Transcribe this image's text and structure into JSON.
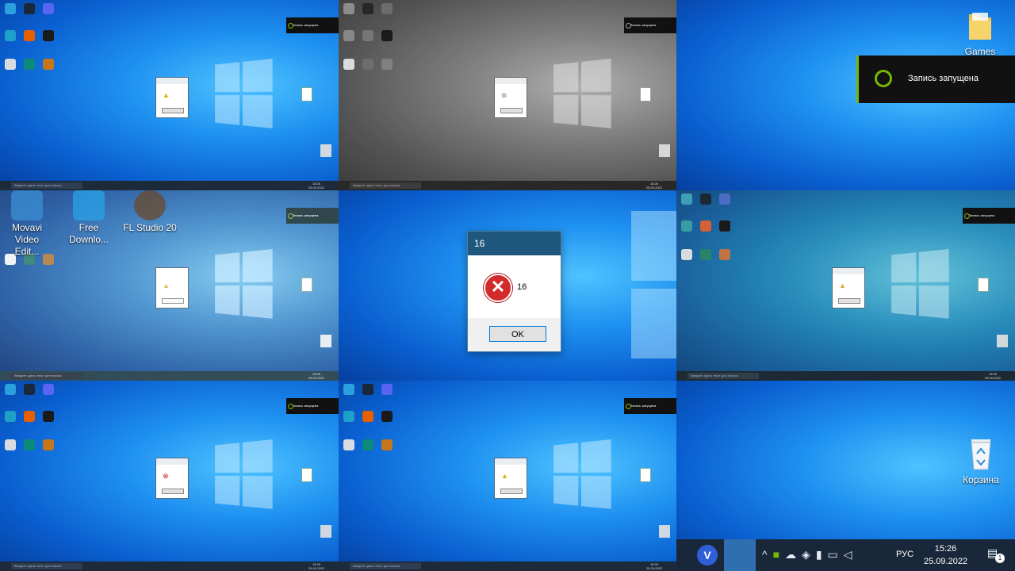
{
  "notification": {
    "text": "Запись запущена"
  },
  "desktop": {
    "folder_label": "Games",
    "recycle_label": "Корзина",
    "shortcuts": [
      {
        "label": "Movavi Video Edit..."
      },
      {
        "label": "Free Downlo..."
      },
      {
        "label": "FL Studio 20"
      }
    ]
  },
  "dialog": {
    "title": "16",
    "message": "16",
    "ok_label": "OK",
    "icon": "error-icon"
  },
  "taskbar": {
    "search_placeholder": "Введите здесь текст для поиска",
    "language": "РУС",
    "time": "15:26",
    "date": "25.09.2022",
    "notification_count": "1",
    "tray_icons": [
      "chevron-up-icon",
      "nvidia-icon",
      "onedrive-icon",
      "security-icon",
      "mic-icon",
      "network-icon",
      "volume-icon"
    ]
  },
  "colors": {
    "accent": "#76b900",
    "dialog_title": "#1f567c",
    "taskbar": "#18273a",
    "error": "#d32b2b"
  }
}
